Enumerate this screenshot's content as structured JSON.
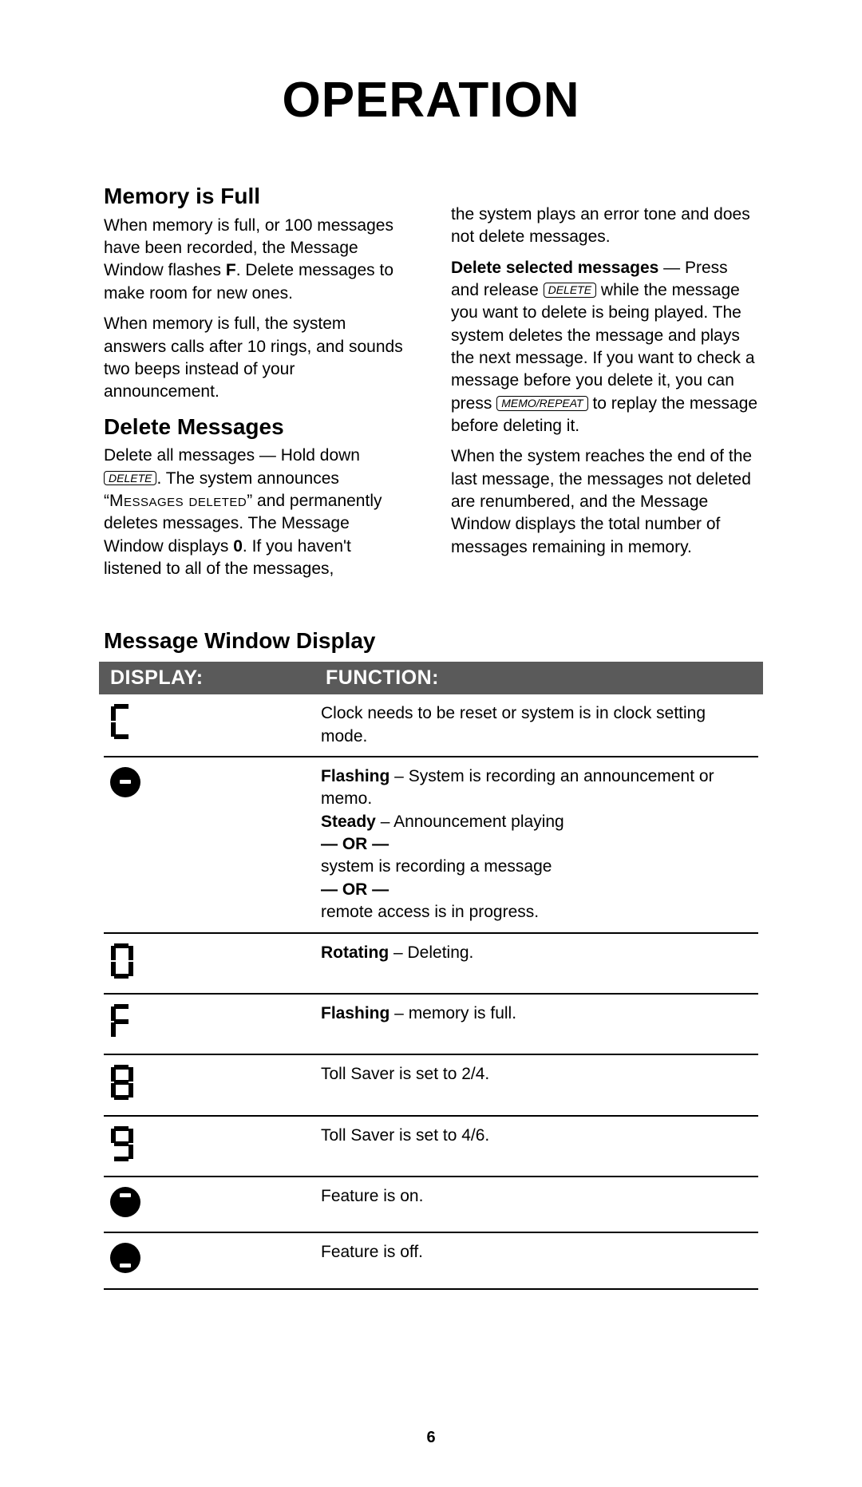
{
  "page_title": "OPERATION",
  "page_number": "6",
  "col1": {
    "h1": "Memory is Full",
    "p1a": "When memory is full, or 100 messages have been recorded, the Message Window flashes ",
    "p1b": "F",
    "p1c": ".  Delete messages to make room for new ones.",
    "p2": "When memory is full, the system answers calls after 10 rings, and sounds two beeps instead of your announcement.",
    "h2": "Delete Messages",
    "p3a": "Delete all messages — Hold down ",
    "key1": "DELETE",
    "p3b": ". The system announces “",
    "p3sc": "Messages deleted",
    "p3c": "” and permanently deletes messages.  The Message Window displays ",
    "p3d": "0",
    "p3e": ".  If you haven't listened to all of the messages,"
  },
  "col2": {
    "p4": "the system plays an error tone and does not delete messages.",
    "p5a": "Delete selected messages",
    "p5b": " — Press and release ",
    "key2": "DELETE",
    "p5c": " while the message you want to delete is being played.  The system deletes the message and plays the next message.  If you want to check a message before you delete it, you can press ",
    "key3": "MEMO/REPEAT",
    "p5d": " to replay the message before deleting it.",
    "p6": "When the system reaches the end of the last message, the messages not deleted are renumbered, and the Message Window displays the total number of messages remaining in memory."
  },
  "table": {
    "heading": "Message Window Display",
    "col1": "DISPLAY:",
    "col2": "FUNCTION:",
    "rows": [
      {
        "icon": "seg-C",
        "func": [
          {
            "t": "Clock needs to be reset or system is in clock setting mode."
          }
        ]
      },
      {
        "icon": "dot-mid",
        "func": [
          {
            "b": "Flashing",
            "t": " – System is recording an announcement or memo."
          },
          {
            "b": "Steady",
            "t": " – Announcement playing"
          },
          {
            "b": "— OR —"
          },
          {
            "t": "system is recording a message"
          },
          {
            "b": "— OR —"
          },
          {
            "t": "remote access is in progress."
          }
        ]
      },
      {
        "icon": "seg-0",
        "func": [
          {
            "b": "Rotating",
            "t": " – Deleting."
          }
        ]
      },
      {
        "icon": "seg-F",
        "func": [
          {
            "b": "Flashing",
            "t": " – memory is full."
          }
        ]
      },
      {
        "icon": "seg-8",
        "func": [
          {
            "t": "Toll Saver is set to 2/4."
          }
        ]
      },
      {
        "icon": "seg-9",
        "func": [
          {
            "t": "Toll Saver is set to 4/6."
          }
        ]
      },
      {
        "icon": "dot-top",
        "func": [
          {
            "t": "Feature is on."
          }
        ]
      },
      {
        "icon": "dot-bot",
        "func": [
          {
            "t": "Feature is off."
          }
        ]
      }
    ]
  }
}
